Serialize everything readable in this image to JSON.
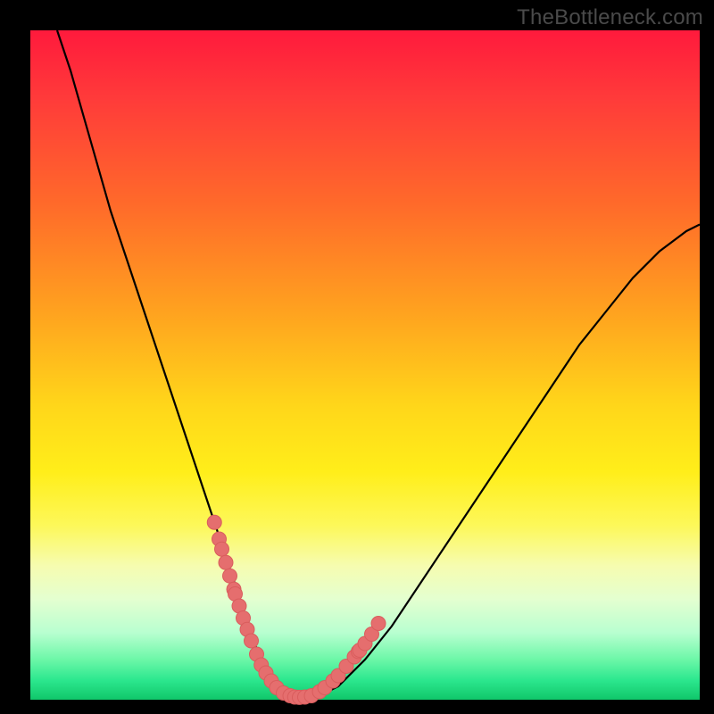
{
  "watermark": "TheBottleneck.com",
  "colors": {
    "curve_stroke": "#000000",
    "marker_fill": "#e56e6e",
    "marker_stroke": "#d95d5d",
    "frame_bg": "#000000"
  },
  "chart_data": {
    "type": "line",
    "title": "",
    "xlabel": "",
    "ylabel": "",
    "xlim": [
      0,
      100
    ],
    "ylim": [
      0,
      100
    ],
    "grid": false,
    "legend": false,
    "series": [
      {
        "name": "bottleneck-curve",
        "x": [
          4,
          6,
          8,
          10,
          12,
          14,
          16,
          18,
          20,
          22,
          24,
          26,
          27,
          28,
          29,
          30,
          31,
          32,
          33,
          34,
          35,
          36,
          37,
          38,
          39,
          40,
          42,
          44,
          46,
          48,
          50,
          54,
          58,
          62,
          66,
          70,
          74,
          78,
          82,
          86,
          90,
          94,
          98,
          100
        ],
        "y": [
          100,
          94,
          87,
          80,
          73,
          67,
          61,
          55,
          49,
          43,
          37,
          31,
          28,
          25,
          22,
          19,
          16,
          13,
          10,
          7,
          5,
          3,
          1.5,
          0.8,
          0.4,
          0.3,
          0.5,
          1,
          2,
          4,
          6,
          11,
          17,
          23,
          29,
          35,
          41,
          47,
          53,
          58,
          63,
          67,
          70,
          71
        ]
      }
    ],
    "markers": {
      "name": "sample-markers",
      "x": [
        27.5,
        28.2,
        28.6,
        29.2,
        29.8,
        30.4,
        30.6,
        31.2,
        31.8,
        32.4,
        33.0,
        33.8,
        34.5,
        35.2,
        36.0,
        36.8,
        37.8,
        38.8,
        39.5,
        40.2,
        41.0,
        42.0,
        43.2,
        44.0,
        45.2,
        46.0,
        47.2,
        48.4,
        49.0,
        49.2,
        50.0,
        51.0,
        52.0
      ],
      "y": [
        26.5,
        24.0,
        22.5,
        20.5,
        18.5,
        16.5,
        15.8,
        14.0,
        12.2,
        10.5,
        8.8,
        6.8,
        5.2,
        4.0,
        2.8,
        1.8,
        1.0,
        0.6,
        0.4,
        0.35,
        0.4,
        0.6,
        1.2,
        1.8,
        2.8,
        3.6,
        5.0,
        6.4,
        7.2,
        7.4,
        8.4,
        9.8,
        11.4
      ]
    }
  }
}
